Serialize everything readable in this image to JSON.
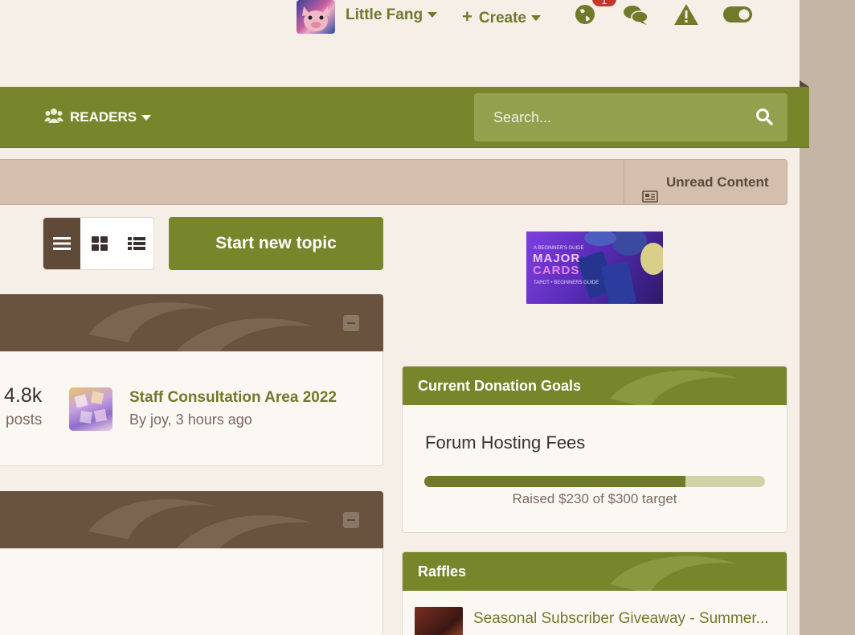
{
  "userbar": {
    "user_name": "Little Fang",
    "create_label": "Create",
    "notification_count": "1"
  },
  "nav": {
    "readers_label": "READERS",
    "search_placeholder": "Search..."
  },
  "breadcrumb": {
    "unread_label": "Unread Content"
  },
  "toolbar": {
    "start_topic_label": "Start new topic"
  },
  "ad": {
    "small_text": "A BEGINNER'S GUIDE",
    "line1": "MAJOR",
    "line2": "CARDS",
    "sub_text": "TAROT • BEGINNERS GUIDE"
  },
  "categories": [
    {
      "stat_value": "4.8k",
      "stat_label": "posts",
      "last_post_title": "Staff Consultation Area 2022",
      "last_post_meta": "By joy, 3 hours ago"
    }
  ],
  "donation_widget": {
    "title": "Current Donation Goals",
    "goal_name": "Forum Hosting Fees",
    "raised_text": "Raised $230 of $300 target",
    "raised": 230,
    "target": 300
  },
  "raffles_widget": {
    "title": "Raffles",
    "item_title": "Seasonal Subscriber Giveaway - Summer..."
  },
  "colors": {
    "brand_green": "#78862b",
    "brown": "#6a533e",
    "page_bg": "#f5efe8"
  }
}
